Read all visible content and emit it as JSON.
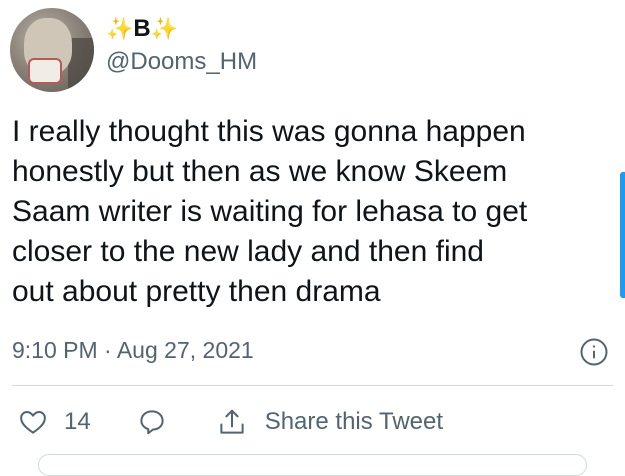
{
  "author": {
    "display_name": "B",
    "sparkle_left": "✨",
    "sparkle_right": "✨",
    "handle": "@Dooms_HM"
  },
  "tweet": {
    "text": "I really thought this was gonna happen\nhonestly but then as we know Skeem\nSaam writer is waiting for lehasa to get\ncloser to the new lady and then find\nout about pretty then drama",
    "time": "9:10 PM",
    "separator": "·",
    "date": "Aug 27, 2021"
  },
  "actions": {
    "like_count": "14",
    "share_label": "Share this Tweet"
  },
  "icons": {
    "info": "info-icon",
    "like": "heart-icon",
    "reply": "reply-icon",
    "share": "share-icon"
  },
  "colors": {
    "text": "#0f1419",
    "secondary": "#536471",
    "accent": "#1d9bf0",
    "sparkle": "#f4b400"
  }
}
